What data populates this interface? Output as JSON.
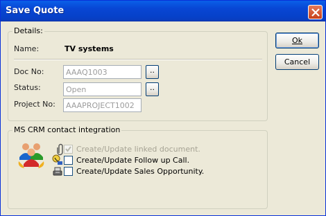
{
  "window": {
    "title": "Save Quote"
  },
  "details": {
    "group_label": "Details:",
    "name_label": "Name:",
    "name_value": "TV systems",
    "doc_no_label": "Doc No:",
    "doc_no_value": "AAAQ1003",
    "status_label": "Status:",
    "status_value": "Open",
    "project_no_label": "Project No:",
    "project_no_value": "AAAPROJECT1002",
    "browse_label": ".."
  },
  "buttons": {
    "ok_label": "Ok",
    "cancel_label": "Cancel"
  },
  "crm": {
    "group_label": "MS CRM contact integration",
    "options": [
      {
        "label": "Create/Update linked document.",
        "checked": true,
        "enabled": false,
        "icon": "paperclip-icon"
      },
      {
        "label": "Create/Update Follow up Call.",
        "checked": false,
        "enabled": true,
        "icon": "phone-call-icon"
      },
      {
        "label": "Create/Update Sales Opportunity.",
        "checked": false,
        "enabled": true,
        "icon": "sales-opportunity-icon"
      }
    ]
  }
}
